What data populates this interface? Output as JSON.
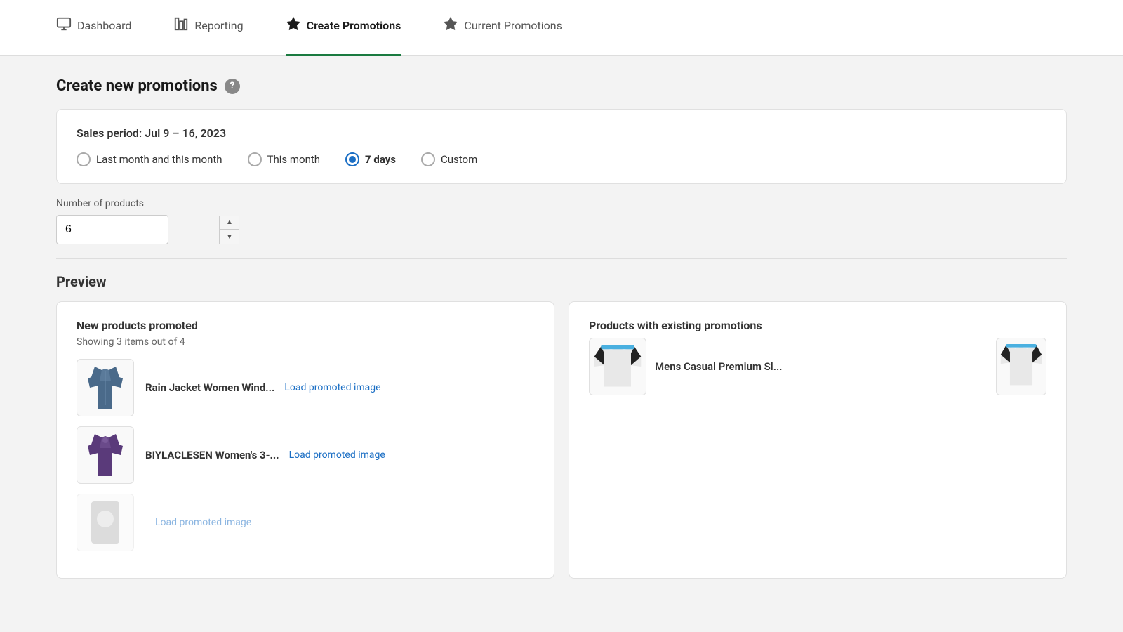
{
  "nav": {
    "items": [
      {
        "id": "dashboard",
        "label": "Dashboard",
        "icon": "monitor",
        "active": false
      },
      {
        "id": "reporting",
        "label": "Reporting",
        "icon": "chart",
        "active": false
      },
      {
        "id": "create-promotions",
        "label": "Create Promotions",
        "icon": "star",
        "active": true
      },
      {
        "id": "current-promotions",
        "label": "Current Promotions",
        "icon": "star",
        "active": false
      }
    ]
  },
  "page": {
    "title": "Create new promotions",
    "help_tooltip": "?"
  },
  "sales_period": {
    "label": "Sales period: Jul 9 – 16, 2023",
    "options": [
      {
        "id": "last-month",
        "label": "Last month and this month",
        "selected": false
      },
      {
        "id": "this-month",
        "label": "This month",
        "selected": false
      },
      {
        "id": "7-days",
        "label": "7 days",
        "selected": true,
        "bold": true
      },
      {
        "id": "custom",
        "label": "Custom",
        "selected": false
      }
    ]
  },
  "products_field": {
    "label": "Number of products",
    "value": "6"
  },
  "preview": {
    "title": "Preview",
    "new_promoted": {
      "title": "New products promoted",
      "subtitle": "Showing 3 items out of 4",
      "items": [
        {
          "name": "Rain Jacket Women Wind...",
          "load_link": "Load promoted image",
          "color": "#3a5a8a"
        },
        {
          "name": "BIYLACLESEN Women's 3-...",
          "load_link": "Load promoted image",
          "color": "#4a2a7a"
        },
        {
          "name": "",
          "load_link": "Load promoted image",
          "color": "#888"
        }
      ]
    },
    "existing_promotions": {
      "title": "Products with existing promotions",
      "items": [
        {
          "name": "Mens Casual Premium Sl...",
          "color": "#ddd"
        }
      ]
    }
  }
}
